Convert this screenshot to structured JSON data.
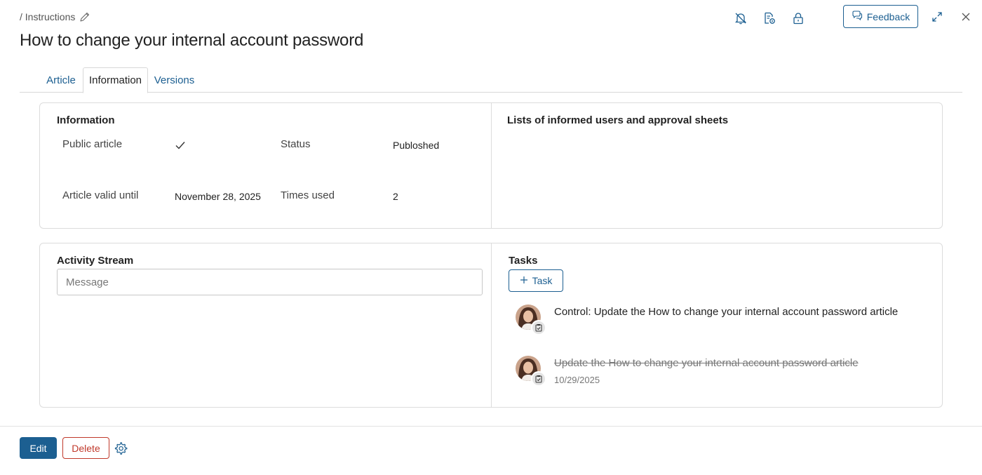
{
  "breadcrumb": {
    "path": "/ Instructions"
  },
  "page": {
    "title": "How to change your internal account password"
  },
  "header": {
    "feedback_label": "Feedback",
    "icons": [
      "bell-off-icon",
      "document-settings-icon",
      "lock-icon",
      "expand-icon",
      "close-icon"
    ]
  },
  "tabs": [
    {
      "label": "Article",
      "active": false
    },
    {
      "label": "Information",
      "active": true
    },
    {
      "label": "Versions",
      "active": false
    }
  ],
  "information": {
    "title": "Information",
    "public_article_label": "Public article",
    "public_article_value": true,
    "status_label": "Status",
    "status_value": "Publoshed",
    "valid_until_label": "Article valid until",
    "valid_until_value": "November 28, 2025",
    "times_used_label": "Times used",
    "times_used_value": "2"
  },
  "informed_lists": {
    "title": "Lists of informed users and approval sheets"
  },
  "activity": {
    "title": "Activity Stream",
    "message_placeholder": "Message"
  },
  "tasks": {
    "title": "Tasks",
    "add_label": "Task",
    "items": [
      {
        "text": "Control: Update the How to change your internal account password article",
        "completed": false,
        "date": ""
      },
      {
        "text": "Update the How to change your internal account password article",
        "completed": true,
        "date": "10/29/2025"
      }
    ]
  },
  "footer": {
    "edit_label": "Edit",
    "delete_label": "Delete"
  },
  "colors": {
    "accent": "#1c5f91",
    "danger": "#c0392b",
    "border": "#dcdcdc"
  }
}
